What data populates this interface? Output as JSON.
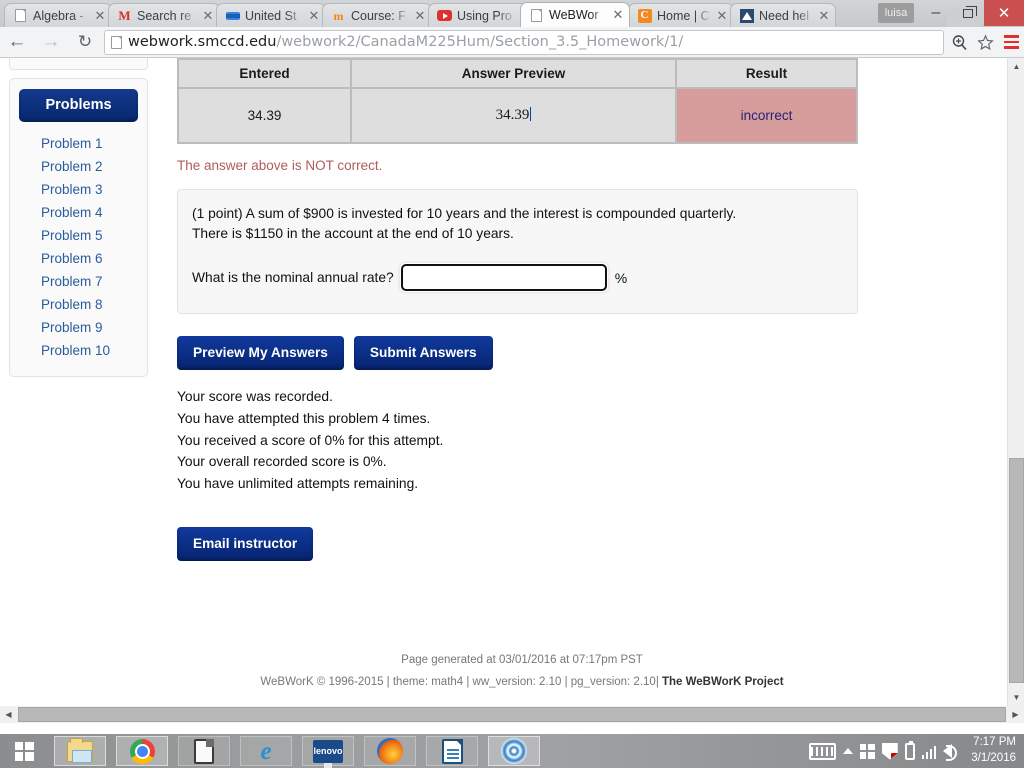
{
  "browser": {
    "tabs": [
      {
        "title": "Algebra -",
        "favicon": "page-icon",
        "active": false
      },
      {
        "title": "Search re",
        "favicon": "gmail-icon",
        "active": false
      },
      {
        "title": "United St",
        "favicon": "bluebar-icon",
        "active": false
      },
      {
        "title": "Course: F",
        "favicon": "moodle-icon",
        "active": false
      },
      {
        "title": "Using Pro",
        "favicon": "youtube-icon",
        "active": false
      },
      {
        "title": "WeBWor",
        "favicon": "page-icon",
        "active": true
      },
      {
        "title": "Home | C",
        "favicon": "canvas-icon",
        "active": false
      },
      {
        "title": "Need hel",
        "favicon": "triangle-icon",
        "active": false
      }
    ],
    "tab_close_glyph": "✕",
    "profile_name": "luisa",
    "window_controls": {
      "minimize": "–",
      "close": "✕"
    },
    "nav": {
      "back": "←",
      "forward": "→",
      "reload": "↻"
    },
    "url": {
      "host": "webwork.smccd.edu",
      "path": "/webwork2/CanadaM225Hum/Section_3.5_Homework/1/"
    }
  },
  "sidebar": {
    "header": "Problems",
    "items": [
      {
        "label": "Problem 1"
      },
      {
        "label": "Problem 2"
      },
      {
        "label": "Problem 3"
      },
      {
        "label": "Problem 4"
      },
      {
        "label": "Problem 5"
      },
      {
        "label": "Problem 6"
      },
      {
        "label": "Problem 7"
      },
      {
        "label": "Problem 8"
      },
      {
        "label": "Problem 9"
      },
      {
        "label": "Problem 10"
      }
    ]
  },
  "answer_table": {
    "headers": [
      "Entered",
      "Answer Preview",
      "Result"
    ],
    "row": {
      "entered": "34.39",
      "preview": "34.39",
      "result": "incorrect"
    },
    "result_bg": "#d79d9d"
  },
  "feedback": {
    "not_correct": "The answer above is NOT correct."
  },
  "problem": {
    "line1": "(1 point) A sum of $900 is invested for 10 years and the interest is compounded quarterly.",
    "line2": "There is $1150 in the account at the end of 10 years.",
    "question_label": "What is the nominal annual rate?",
    "answer_value": "",
    "answer_placeholder": "",
    "unit": "%"
  },
  "buttons": {
    "preview": "Preview My Answers",
    "submit": "Submit Answers",
    "email_instructor": "Email instructor"
  },
  "score": {
    "lines": [
      "Your score was recorded.",
      "You have attempted this problem 4 times.",
      "You received a score of 0% for this attempt.",
      "Your overall recorded score is 0%.",
      "You have unlimited attempts remaining."
    ]
  },
  "footer": {
    "generated": "Page generated at 03/01/2016 at 07:17pm PST",
    "credits_prefix": "WeBWorK © 1996-2015 | theme: math4 | ww_version: 2.10 | pg_version: 2.10| ",
    "credits_project": "The WeBWorK Project"
  },
  "taskbar": {
    "items": [
      {
        "name": "file-explorer",
        "icon": "folder-icon",
        "running": true
      },
      {
        "name": "google-chrome",
        "icon": "chrome-icon",
        "running": true
      },
      {
        "name": "document-app",
        "icon": "document-icon",
        "running": false
      },
      {
        "name": "internet-explorer",
        "icon": "ie-icon",
        "running": false
      },
      {
        "name": "lenovo-app",
        "icon": "lenovo-icon",
        "running": false
      },
      {
        "name": "firefox",
        "icon": "firefox-icon",
        "running": false
      },
      {
        "name": "libreoffice-writer",
        "icon": "writer-icon",
        "running": false
      },
      {
        "name": "spiral-app",
        "icon": "spiral-icon",
        "running": true
      }
    ],
    "clock": {
      "time": "7:17 PM",
      "date": "3/1/2016"
    }
  }
}
